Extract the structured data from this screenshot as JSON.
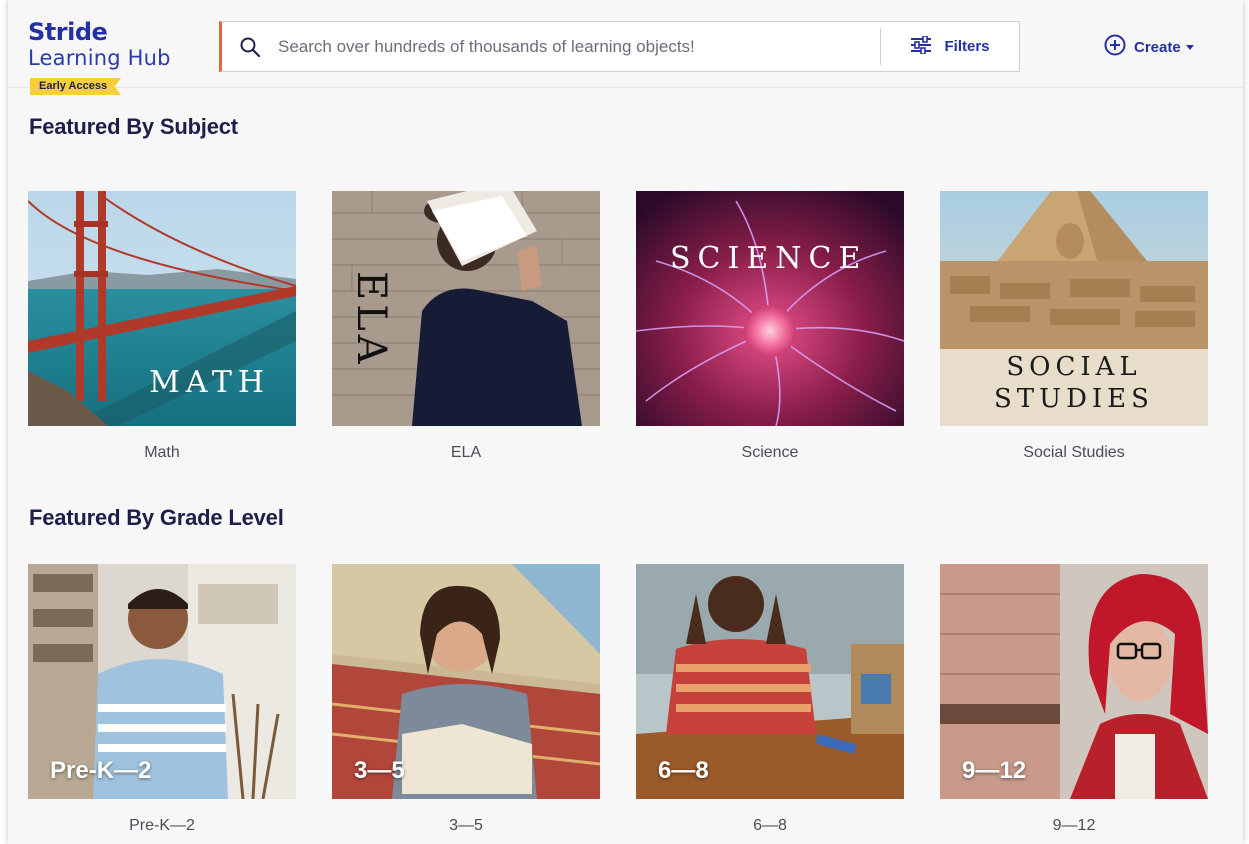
{
  "header": {
    "logo_brand": "Stride",
    "logo_sub": "Learning Hub",
    "badge": "Early Access",
    "search_placeholder": "Search over hundreds of thousands of learning objects!",
    "filters_label": "Filters",
    "create_label": "Create"
  },
  "subjects": {
    "title": "Featured By Subject",
    "items": [
      {
        "label": "Math",
        "overlay": "MATH"
      },
      {
        "label": "ELA",
        "overlay": "ELA"
      },
      {
        "label": "Science",
        "overlay": "SCIENCE"
      },
      {
        "label": "Social Studies",
        "overlay_line1": "SOCIAL",
        "overlay_line2": "STUDIES"
      }
    ]
  },
  "grades": {
    "title": "Featured By Grade Level",
    "items": [
      {
        "label": "Pre-K—2",
        "overlay": "Pre-K—2"
      },
      {
        "label": "3—5",
        "overlay": "3—5"
      },
      {
        "label": "6—8",
        "overlay": "6—8"
      },
      {
        "label": "9—12",
        "overlay": "9—12"
      }
    ]
  },
  "colors": {
    "brand": "#2431a3",
    "accent": "#e8643a",
    "badge": "#f6cf3a",
    "heading": "#1b1f4a"
  },
  "icons": [
    "search-icon",
    "sliders-icon",
    "plus-circle-icon",
    "caret-down-icon"
  ]
}
